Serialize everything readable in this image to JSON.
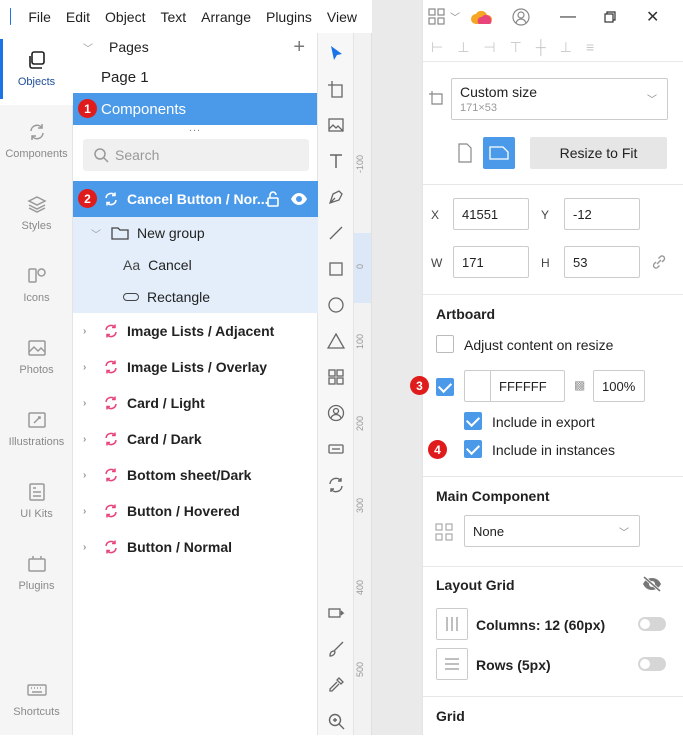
{
  "menu": [
    "File",
    "Edit",
    "Object",
    "Text",
    "Arrange",
    "Plugins",
    "View"
  ],
  "rail": [
    {
      "label": "Objects",
      "icon": "objects-icon"
    },
    {
      "label": "Components",
      "icon": "components-icon"
    },
    {
      "label": "Styles",
      "icon": "styles-icon"
    },
    {
      "label": "Icons",
      "icon": "icons-icon"
    },
    {
      "label": "Photos",
      "icon": "photos-icon"
    },
    {
      "label": "Illustrations",
      "icon": "illustrations-icon"
    },
    {
      "label": "UI Kits",
      "icon": "ui-kits-icon"
    },
    {
      "label": "Plugins",
      "icon": "plugins-icon"
    },
    {
      "label": "Shortcuts",
      "icon": "keyboard-icon"
    }
  ],
  "pages": {
    "header": "Pages",
    "items": [
      "Page 1",
      "Components"
    ],
    "selected": "Components"
  },
  "search": {
    "placeholder": "Search"
  },
  "layers": {
    "selected": "Cancel Button / Nor...",
    "group": "New group",
    "children": [
      "Cancel",
      "Rectangle"
    ],
    "components": [
      "Image Lists / Adjacent",
      "Image Lists / Overlay",
      "Card / Light",
      "Card / Dark",
      "Bottom sheet/Dark",
      "Button / Hovered",
      "Button / Normal"
    ]
  },
  "badges": [
    "1",
    "2",
    "3",
    "4"
  ],
  "ruler": [
    "-100",
    "0",
    "100",
    "200",
    "300",
    "400",
    "500"
  ],
  "inspector": {
    "size_preset": "Custom size",
    "size_sub": "171×53",
    "resize_button": "Resize to Fit",
    "x_label": "X",
    "x_value": "41551",
    "y_label": "Y",
    "y_value": "-12",
    "w_label": "W",
    "w_value": "171",
    "h_label": "H",
    "h_value": "53",
    "artboard_title": "Artboard",
    "adjust_label": "Adjust content on resize",
    "fill_hex": "FFFFFF",
    "fill_opacity": "100%",
    "include_export": "Include in export",
    "include_instances": "Include in instances",
    "main_component_title": "Main Component",
    "main_component_value": "None",
    "layout_grid_title": "Layout Grid",
    "columns_label": "Columns: 12 (60px)",
    "rows_label": "Rows (5px)",
    "grid_title": "Grid"
  },
  "colors": {
    "accent": "#4b9ae9",
    "badge": "#e01b1b",
    "component": "#e8457a"
  }
}
